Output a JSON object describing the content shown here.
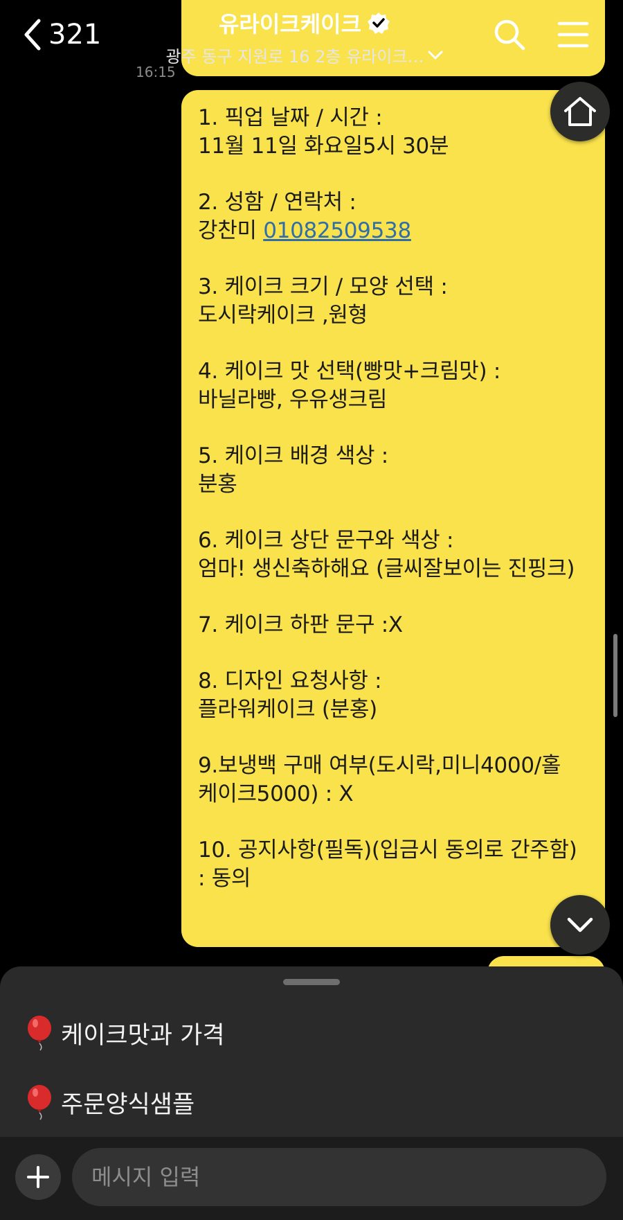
{
  "header": {
    "back_count": "321",
    "title": "유라이크케이크",
    "subtitle": "광주 동구 지원로 16 2층 유라이크…"
  },
  "chat": {
    "timestamp": "16:15",
    "message": {
      "s1": [
        "1. 픽업 날짜 / 시간 :",
        "11월 11일 화요일5시 30분"
      ],
      "s2_label": "2. 성함 / 연락처 :",
      "s2_name": "강찬미 ",
      "s2_phone": "01082509538",
      "s3": [
        "3. 케이크 크기 / 모양 선택 :",
        "도시락케이크 ,원형"
      ],
      "s4": [
        "4. 케이크 맛 선택(빵맛+크림맛) :",
        "바닐라빵, 우유생크림"
      ],
      "s5": [
        "5. 케이크 배경 색상 :",
        "분홍"
      ],
      "s6": [
        "6. 케이크 상단 문구와 색상 :",
        "엄마! 생신축하해요 (글씨잘보이는 진핑크)"
      ],
      "s7": [
        "7. 케이크 하판 문구 :X"
      ],
      "s8": [
        "8. 디자인 요청사항 :",
        "플라워케이크 (분홍)"
      ],
      "s9": [
        "9.보냉백 구매 여부(도시락,미니4000/홀",
        "케이크5000) : X"
      ],
      "s10": [
        "10. 공지사항(필독)(입금시 동의로 간주함)",
        ": 동의"
      ]
    }
  },
  "quick_menu": {
    "items": [
      {
        "icon": "balloon-icon",
        "label": "케이크맛과 가격"
      },
      {
        "icon": "balloon-icon",
        "label": "주문양식샘플"
      }
    ]
  },
  "composer": {
    "placeholder": "메시지 입력"
  },
  "colors": {
    "bubble": "#f9e24c",
    "background": "#000000",
    "sheet": "#2a2a2a",
    "link": "#2f6ea8"
  }
}
